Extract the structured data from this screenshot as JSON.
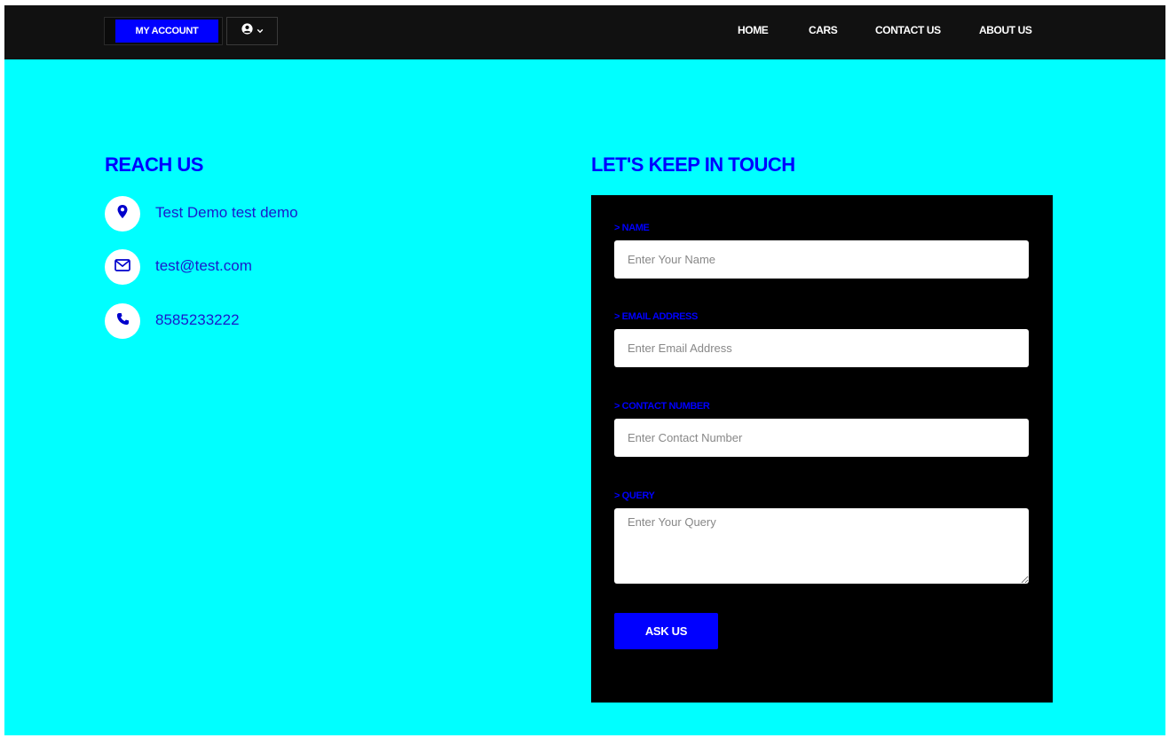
{
  "header": {
    "account_button": "MY ACCOUNT",
    "user_menu_icon": "user-circle-icon",
    "nav": [
      "HOME",
      "CARS",
      "CONTACT US",
      "ABOUT US"
    ]
  },
  "reach": {
    "title": "REACH US",
    "items": [
      {
        "icon": "map-marker-icon",
        "text": "Test Demo test demo"
      },
      {
        "icon": "envelope-icon",
        "text": "test@test.com"
      },
      {
        "icon": "phone-icon",
        "text": "8585233222"
      }
    ]
  },
  "form": {
    "title": "LET'S KEEP IN TOUCH",
    "fields": [
      {
        "label": "> NAME",
        "placeholder": "Enter Your Name"
      },
      {
        "label": "> EMAIL ADDRESS",
        "placeholder": "Enter Email Address"
      },
      {
        "label": "> CONTACT NUMBER",
        "placeholder": "Enter Contact Number"
      },
      {
        "label": "> QUERY",
        "placeholder": "Enter Your Query"
      }
    ],
    "submit": "ASK US"
  },
  "colors": {
    "page_background": "#00ffff",
    "topbar": "#111111",
    "accent": "#0000ff",
    "form_panel": "#000000"
  }
}
